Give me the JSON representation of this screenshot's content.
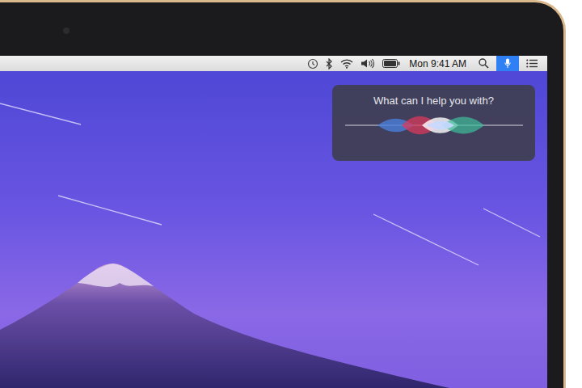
{
  "menu_bar": {
    "clock": "Mon 9:41 AM",
    "siri_active": true
  },
  "siri": {
    "prompt": "What can I help you with?"
  }
}
